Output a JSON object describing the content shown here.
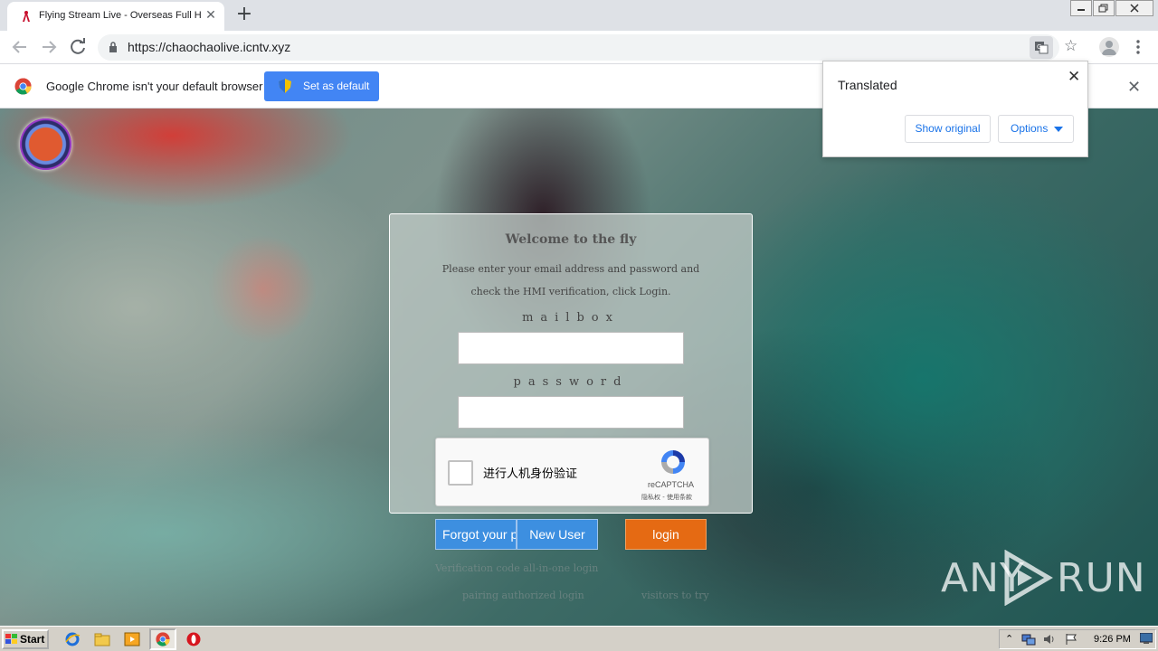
{
  "browser": {
    "tab": {
      "title": "Flying Stream Live - Overseas Full HD",
      "close": "✕"
    },
    "newtab": "+",
    "url": "https://chaochaolive.icntv.xyz"
  },
  "infobar": {
    "message": "Google Chrome isn't your default browser",
    "button": "Set as default",
    "close": "✕"
  },
  "translate_popup": {
    "title": "Translated",
    "close": "✕",
    "show_original": "Show original",
    "options": "Options"
  },
  "login": {
    "title": "Welcome to the fly",
    "description": "Please enter your email address and password and check the HMI verification, click Login.",
    "mailbox_label": "mailbox",
    "password_label": "password",
    "mailbox_value": "",
    "password_value": "",
    "recaptcha": {
      "text": "进行人机身份验证",
      "brand": "reCAPTCHA",
      "terms": "隐私权 - 使用条款"
    },
    "forgot_button": "Forgot your password",
    "new_user_button": "New User",
    "login_button": "login",
    "verification_link": "Verification code all-in-one login",
    "pairing_link": "pairing authorized login",
    "visitors_link": "visitors to try"
  },
  "watermark": {
    "left": "ANY",
    "right": "RUN"
  },
  "taskbar": {
    "start": "Start",
    "clock": "9:26 PM"
  },
  "colors": {
    "primary_button": "#3d8fe0",
    "login_button": "#e56a13",
    "chrome_blue": "#4285f4"
  }
}
